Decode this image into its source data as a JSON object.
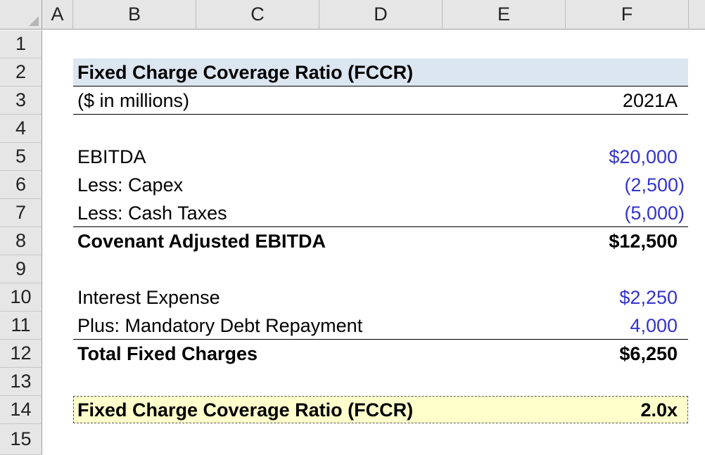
{
  "columns": [
    "A",
    "B",
    "C",
    "D",
    "E",
    "F"
  ],
  "rows": [
    "1",
    "2",
    "3",
    "4",
    "5",
    "6",
    "7",
    "8",
    "9",
    "10",
    "11",
    "12",
    "13",
    "14",
    "15"
  ],
  "title": "Fixed Charge Coverage Ratio (FCCR)",
  "units_label": "($ in millions)",
  "period": "2021A",
  "lines": {
    "ebitda": {
      "label": "EBITDA",
      "value": "$20,000"
    },
    "capex": {
      "label": "Less: Capex",
      "value": "(2,500)"
    },
    "cash_taxes": {
      "label": "Less: Cash Taxes",
      "value": "(5,000)"
    },
    "covenant_ebitda": {
      "label": "Covenant Adjusted EBITDA",
      "value": "$12,500"
    },
    "interest": {
      "label": "Interest Expense",
      "value": "$2,250"
    },
    "debt_repayment": {
      "label": "Plus: Mandatory Debt Repayment",
      "value": "4,000"
    },
    "total_fixed": {
      "label": "Total Fixed Charges",
      "value": "$6,250"
    },
    "fccr": {
      "label": "Fixed Charge Coverage Ratio (FCCR)",
      "value": "2.0x"
    }
  },
  "colors": {
    "header_fill": "#dce6f1",
    "result_fill": "#ffffcc",
    "input_font": "#3333cc",
    "grid_header": "#e6e6e6"
  }
}
